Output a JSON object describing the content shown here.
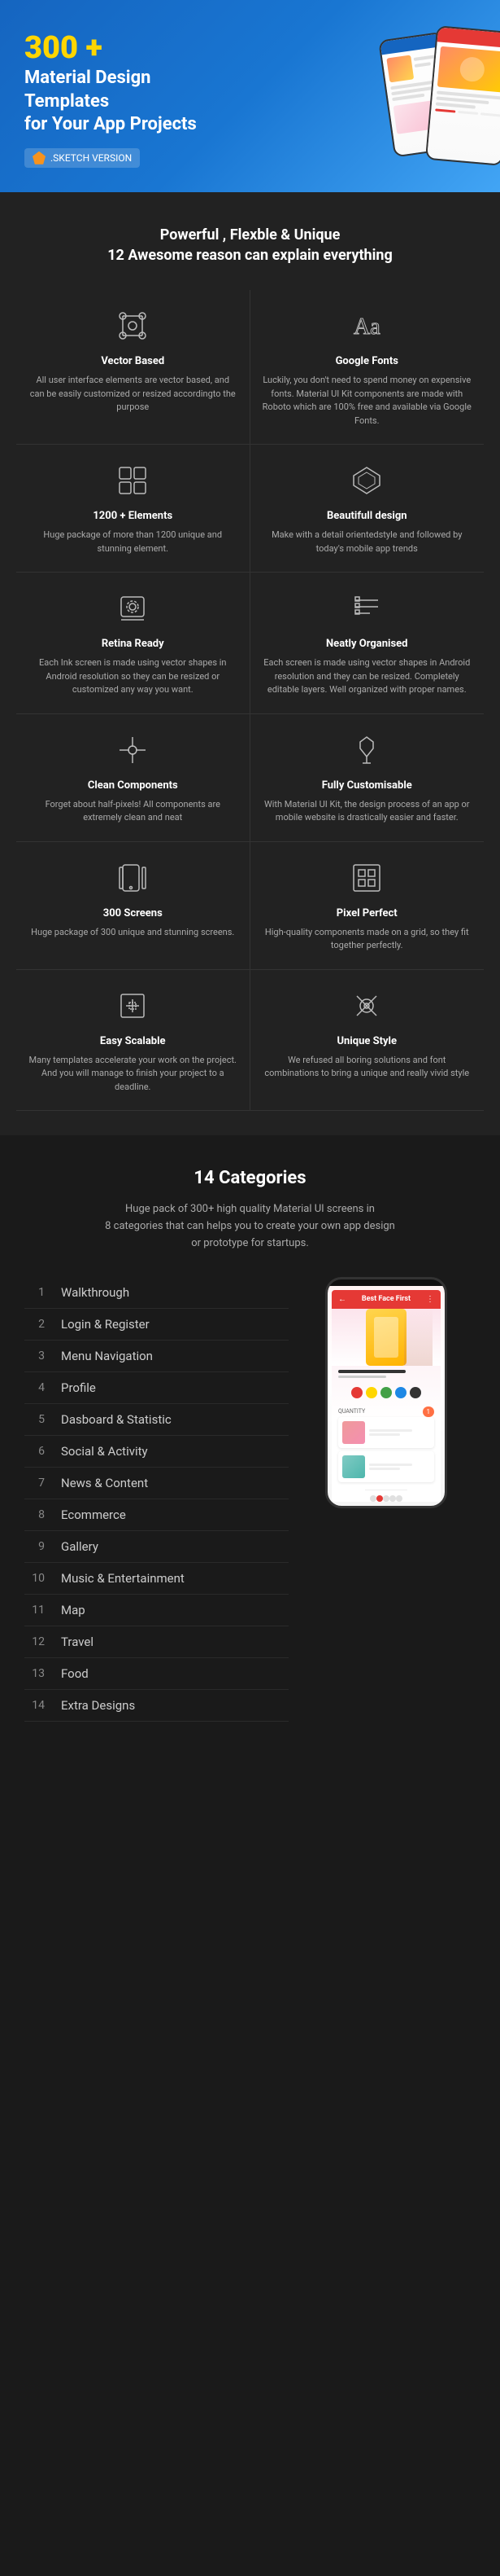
{
  "hero": {
    "title_number": "300 +",
    "title_line1": "Material Design",
    "title_line2": "Templates",
    "title_line3": "for Your App Projects",
    "badge_text": ".SKETCH VERSION"
  },
  "features_section": {
    "title_line1": "Powerful , Flexble & Unique",
    "title_line2": "12 Awesome reason can explain everything",
    "features": [
      {
        "id": "vector-based",
        "name": "Vector Based",
        "desc": "All user interface elements are vector based, and can be easily customized or resized accordingto the purpose"
      },
      {
        "id": "google-fonts",
        "name": "Google Fonts",
        "desc": "Luckily, you don't need to spend money on expensive fonts. Material UI Kit components are made with Roboto which are 100% free and available via Google Fonts."
      },
      {
        "id": "1200-elements",
        "name": "1200 + Elements",
        "desc": "Huge package of more than 1200 unique and stunning element."
      },
      {
        "id": "beautiful-design",
        "name": "Beautifull design",
        "desc": "Make with a detail orientedstyle and followed by today's mobile app trends"
      },
      {
        "id": "retina-ready",
        "name": "Retina Ready",
        "desc": "Each Ink screen is made using vector shapes in Android resolution so they can be resized or customized any way you want."
      },
      {
        "id": "neatly-organised",
        "name": "Neatly Organised",
        "desc": "Each screen is made using vector shapes in Android resolution and they can be resized. Completely editable layers. Well organized with proper names."
      },
      {
        "id": "clean-components",
        "name": "Clean Components",
        "desc": "Forget about half-pixels! All components are extremely clean and neat"
      },
      {
        "id": "fully-customisable",
        "name": "Fully Customisable",
        "desc": "With Material UI Kit, the design process of an app or mobile website is drastically easier and faster."
      },
      {
        "id": "300-screens",
        "name": "300 Screens",
        "desc": "Huge package of 300 unique and stunning screens."
      },
      {
        "id": "pixel-perfect",
        "name": "Pixel Perfect",
        "desc": "High-quality components made on a grid, so they fit together perfectly."
      },
      {
        "id": "easy-scalable",
        "name": "Easy Scalable",
        "desc": "Many templates accelerate your work on the project. And you will manage to finish your project to a deadline."
      },
      {
        "id": "unique-style",
        "name": "Unique Style",
        "desc": "We refused all boring solutions and font combinations to bring a unique and really vivid style"
      }
    ]
  },
  "categories_section": {
    "title": "14 Categories",
    "subtitle": "Huge pack of 300+ high quality Material UI screens in\n8 categories that can helps you to create your own app design\nor prototype for startups.",
    "categories": [
      {
        "num": "1",
        "label": "Walkthrough"
      },
      {
        "num": "2",
        "label": "Login & Register"
      },
      {
        "num": "3",
        "label": "Menu Navigation"
      },
      {
        "num": "4",
        "label": "Profile"
      },
      {
        "num": "5",
        "label": "Dasboard & Statistic"
      },
      {
        "num": "6",
        "label": "Social & Activity"
      },
      {
        "num": "7",
        "label": "News & Content"
      },
      {
        "num": "8",
        "label": "Ecommerce"
      },
      {
        "num": "9",
        "label": "Gallery"
      },
      {
        "num": "10",
        "label": "Music & Entertainment"
      },
      {
        "num": "11",
        "label": "Map"
      },
      {
        "num": "12",
        "label": "Travel"
      },
      {
        "num": "13",
        "label": "Food"
      },
      {
        "num": "14",
        "label": "Extra Designs"
      }
    ]
  }
}
